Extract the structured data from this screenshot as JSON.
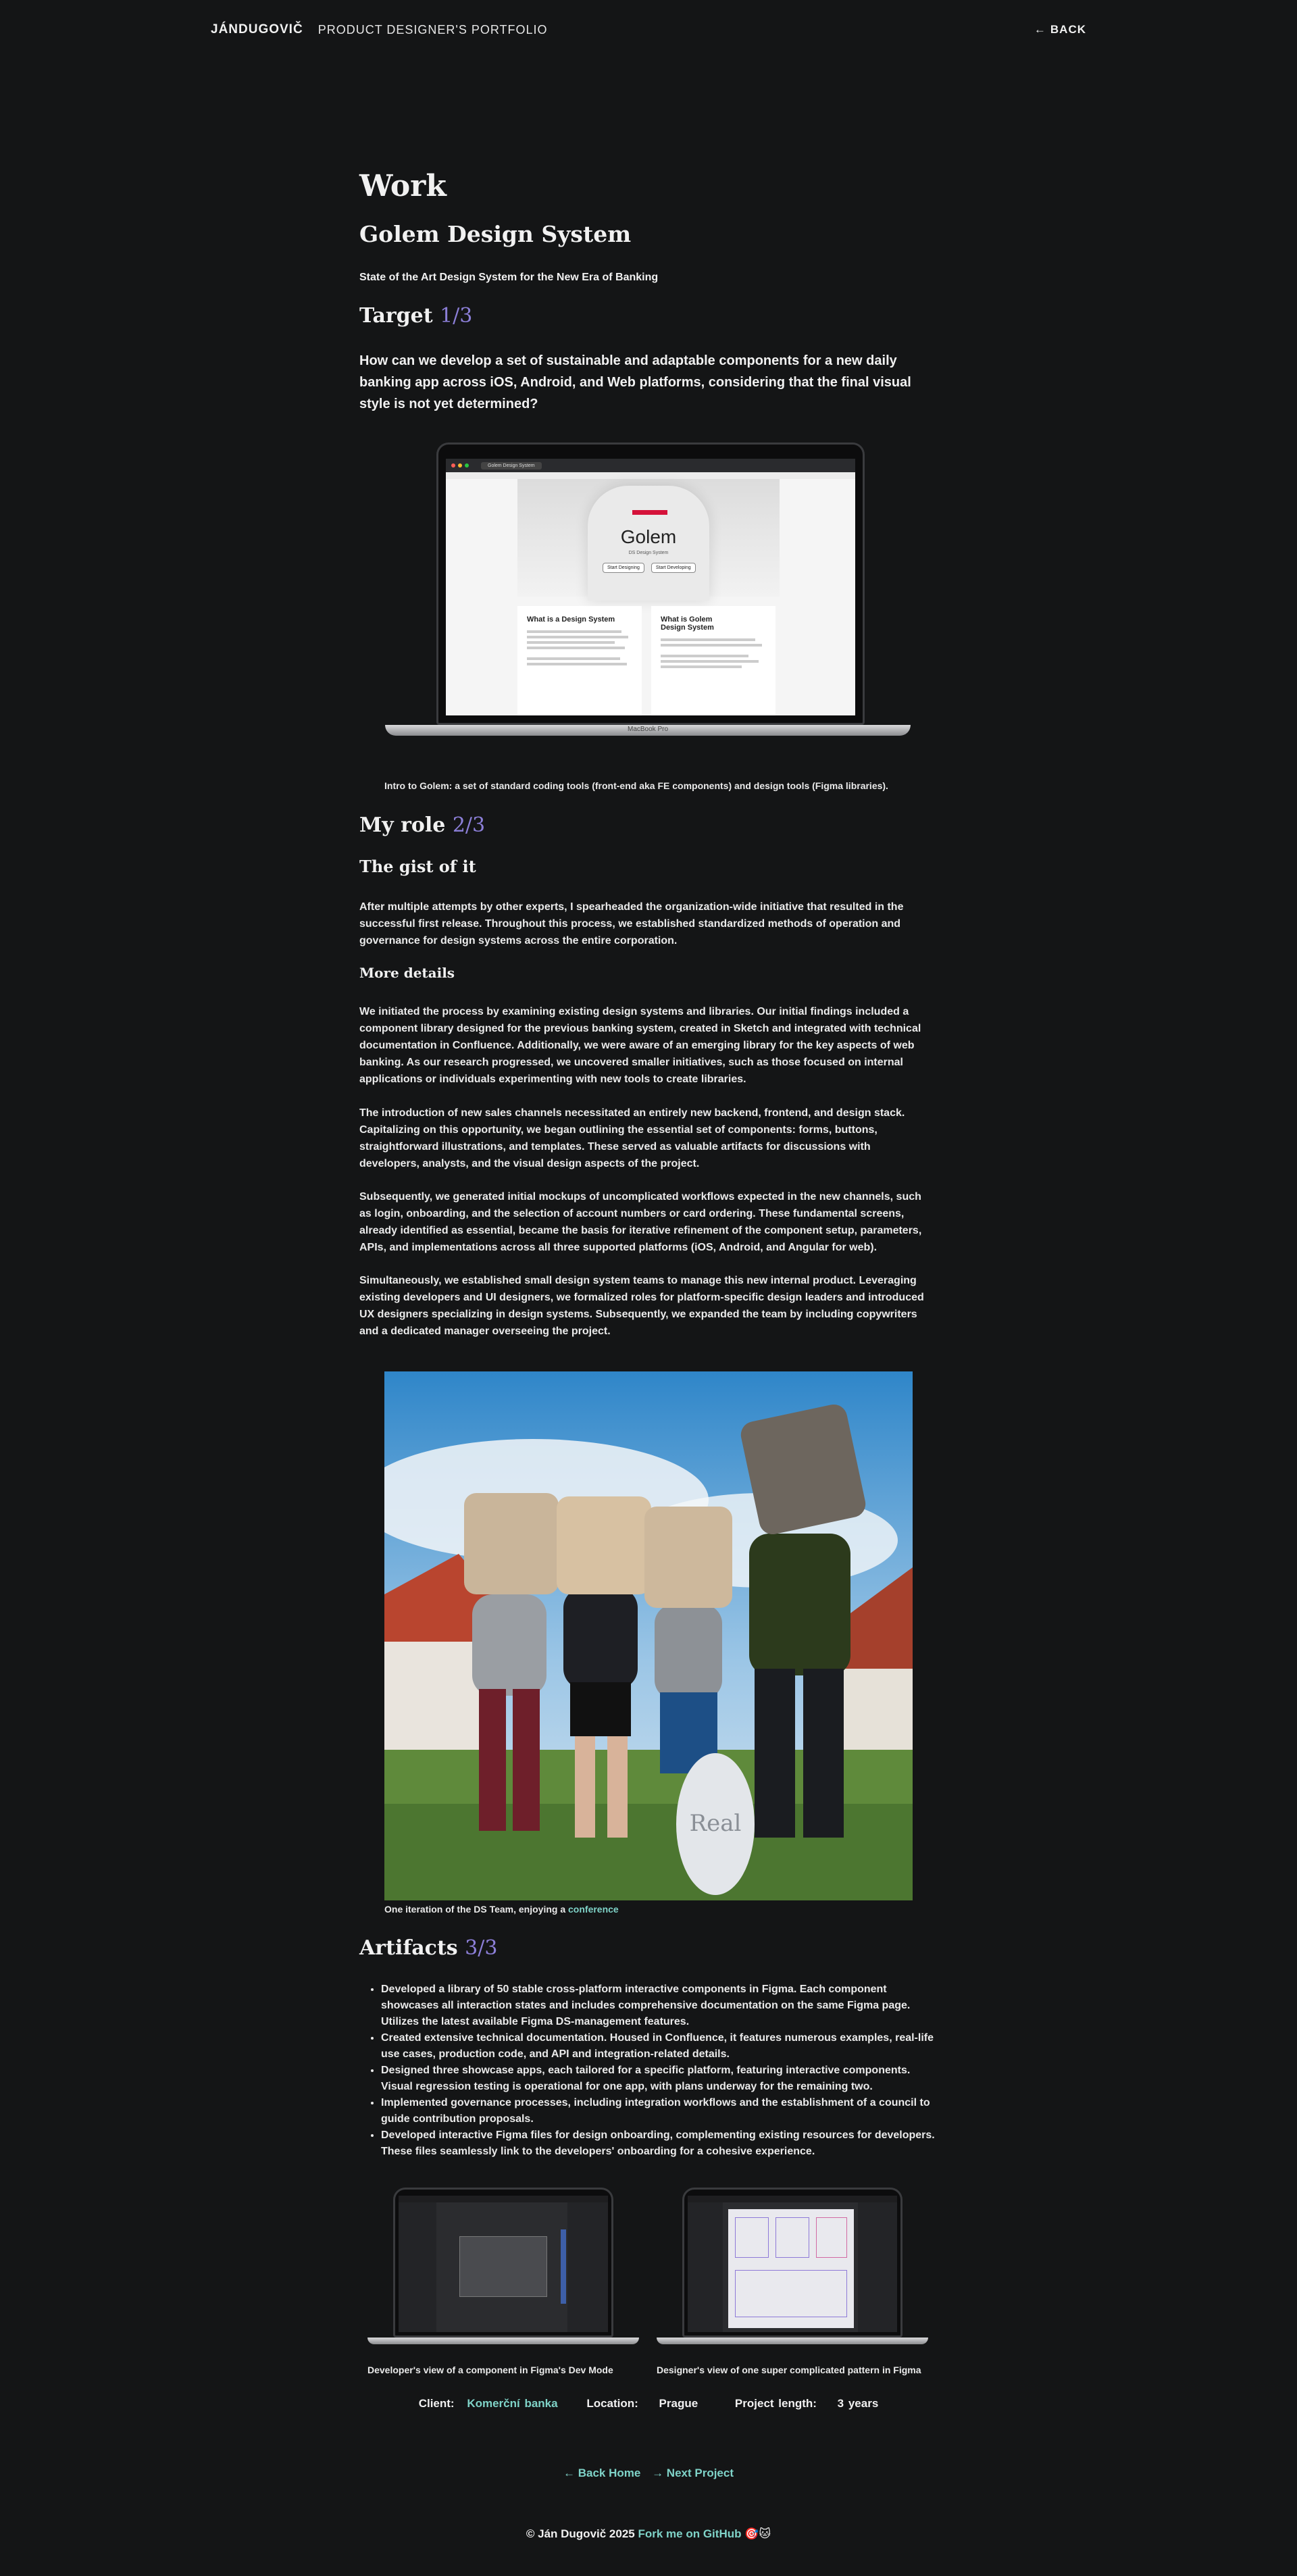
{
  "header": {
    "brand": "JÁNDUGOVIČ",
    "subtitle": "PRODUCT DESIGNER'S PORTFOLIO",
    "back": "BACK"
  },
  "page": {
    "heading": "Work",
    "project": "Golem Design System",
    "tagline": "State of the Art Design System for the New Era of Banking"
  },
  "target": {
    "title": "Target",
    "step": "1/3",
    "question": "How can we develop a set of sustainable and adaptable components for a new daily banking app across iOS, Android, and Web platforms, considering that the final visual style is not yet determined?",
    "caption": "Intro to Golem: a set of standard coding tools (front-end aka FE components) and design tools (Figma libraries).",
    "laptop_label": "MacBook Pro",
    "screen": {
      "tab": "Golem Design System",
      "hero_title": "Golem",
      "hero_sub": "DS Design System",
      "btn1": "Start Designing",
      "btn2": "Start Developing",
      "card1_title": "What is a Design System",
      "card2_title": "What is Golem Design System"
    }
  },
  "role": {
    "title": "My role",
    "step": "2/3",
    "gist_title": "The gist of it",
    "gist": "After multiple attempts by other experts, I spearheaded the organization-wide initiative that resulted in the successful first release. Throughout this process, we established standardized methods of operation and governance for design systems across the entire corporation.",
    "details_title": "More details",
    "p1": "We initiated the process by examining existing design systems and libraries. Our initial findings included a component library designed for the previous banking system, created in Sketch and integrated with technical documentation in Confluence. Additionally, we were aware of an emerging library for the key aspects of web banking. As our research progressed, we uncovered smaller initiatives, such as those focused on internal applications or individuals experimenting with new tools to create libraries.",
    "p2": "The introduction of new sales channels necessitated an entirely new backend, frontend, and design stack. Capitalizing on this opportunity, we began outlining the essential set of components: forms, buttons, straightforward illustrations, and templates. These served as valuable artifacts for discussions with developers, analysts, and the visual design aspects of the project.",
    "p3": "Subsequently, we generated initial mockups of uncomplicated workflows expected in the new channels, such as login, onboarding, and the selection of account numbers or card ordering. These fundamental screens, already identified as essential, became the basis for iterative refinement of the component setup, parameters, APIs, and implementations across all three supported platforms (iOS, Android, and Angular for web).",
    "p4": "Simultaneously, we established small design system teams to manage this new internal product. Leveraging existing developers and UI designers, we formalized roles for platform-specific design leaders and introduced UX designers specializing in design systems. Subsequently, we expanded the team by including copywriters and a dedicated manager overseeing the project.",
    "photo_caption": "One iteration of the DS Team, enjoying a",
    "photo_link": "conference"
  },
  "artifacts": {
    "title": "Artifacts",
    "step": "3/3",
    "items": [
      "Developed a library of 50 stable cross-platform interactive components in Figma. Each component showcases all interaction states and includes comprehensive documentation on the same Figma page. Utilizes the latest available Figma DS-management features.",
      "Created extensive technical documentation. Housed in Confluence, it features numerous examples, real-life use cases, production code, and API and integration-related details.",
      "Designed three showcase apps, each tailored for a specific platform, featuring interactive components. Visual regression testing is operational for one app, with plans underway for the remaining two.",
      "Implemented governance processes, including integration workflows and the establishment of a council to guide contribution proposals.",
      "Developed interactive Figma files for design onboarding, complementing existing resources for developers. These files seamlessly link to the developers' onboarding for a cohesive experience."
    ],
    "shot1_caption": "Developer's view of a component in Figma's Dev Mode",
    "shot2_caption": "Designer's view of one super complicated pattern in Figma"
  },
  "meta": {
    "client_label": "Client:",
    "client": "Komerční banka",
    "location_label": "Location:",
    "location": "Prague",
    "length_label": "Project length:",
    "length": "3 years"
  },
  "nav": {
    "home": "Back Home",
    "next": "Next Project"
  },
  "footer": {
    "copyright": "© Ján Dugovič 2025",
    "fork": "Fork me on GitHub",
    "emoji": "🎯🐱"
  },
  "colors": {
    "background": "#141516",
    "accent": "#8c7fd8",
    "link": "#7fd3c8"
  }
}
